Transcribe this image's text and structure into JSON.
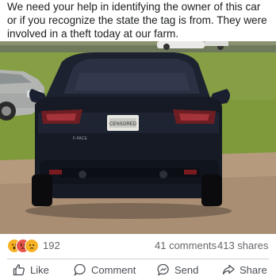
{
  "post": {
    "caption": "We need your help in identifying the owner of this car or if you recognize the state the tag is from. They were involved in a theft today at our farm.",
    "photo": {
      "plate_text": "CENSORED",
      "badge_text": "F-PACE"
    }
  },
  "engagement": {
    "reaction_icons": [
      "wow-emoji-icon",
      "angry-emoji-icon",
      "sad-emoji-icon"
    ],
    "reaction_count": "192",
    "comments": "41 comments",
    "shares": "413 shares"
  },
  "actions": {
    "like": "Like",
    "comment": "Comment",
    "send": "Send",
    "share": "Share"
  },
  "colors": {
    "text": "#1c1e21",
    "muted": "#65676b",
    "divider": "#ced0d4"
  }
}
